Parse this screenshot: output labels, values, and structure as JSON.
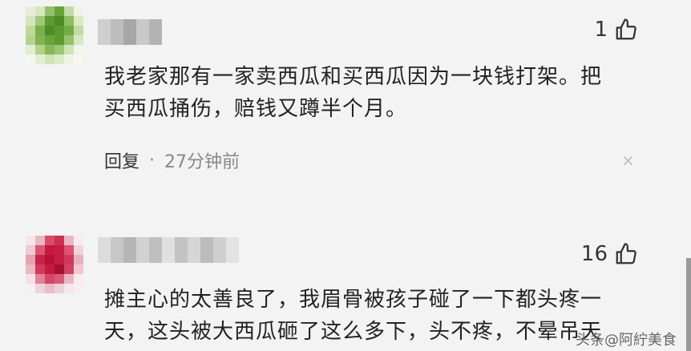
{
  "comments": [
    {
      "likes": "1",
      "lines": [
        "我老家那有一家卖西瓜和买西瓜因为一块钱打架。把",
        "买西瓜捅伤，赔钱又蹲半个月。"
      ],
      "reply_label": "回复",
      "separator": "·",
      "time": "27分钟前",
      "close_symbol": "×"
    },
    {
      "likes": "16",
      "lines": [
        "摊主心的太善良了，我眉骨被孩子碰了一下都头疼一",
        "天，这头被大西瓜砸了这么多下，头不疼，不晕吊天"
      ]
    }
  ],
  "watermark": "头条@阿紵美食",
  "icons": {
    "like": "thumbs-up-icon",
    "close": "close-icon"
  },
  "colors": {
    "background": "#f3f3f3",
    "text": "#222222",
    "meta": "#888888"
  }
}
